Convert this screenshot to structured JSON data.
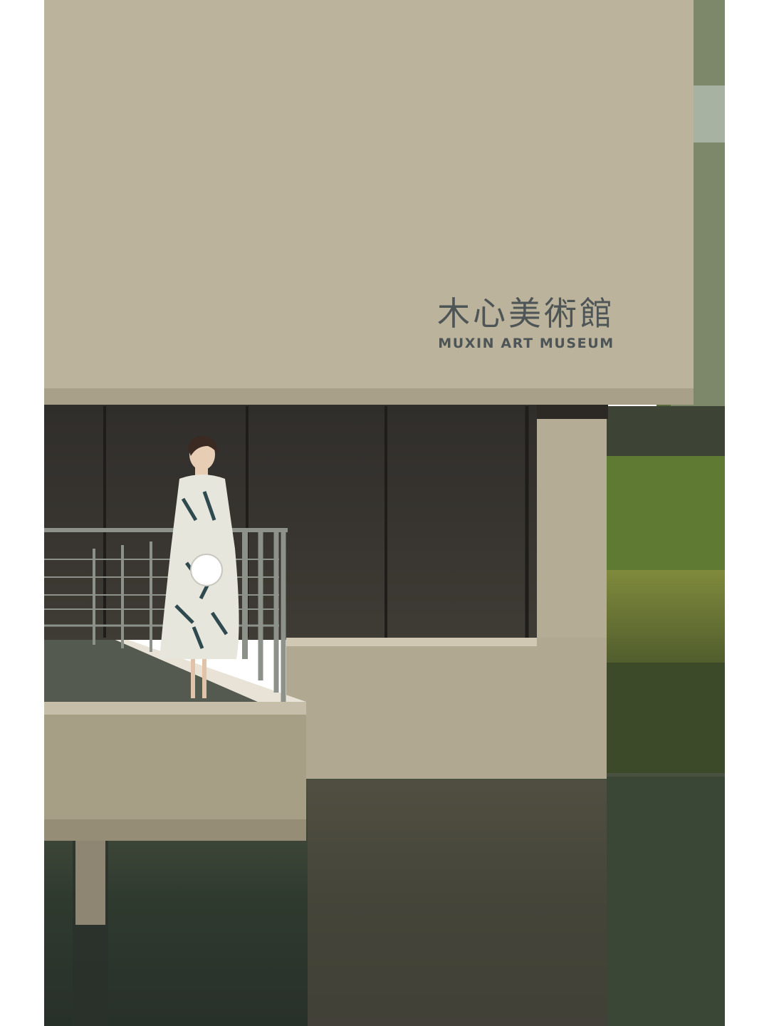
{
  "photo": {
    "subject": "museum-facade-with-person-on-balcony",
    "sign": {
      "chinese": "木心美術館",
      "english": "MUXIN ART MUSEUM"
    }
  },
  "colors": {
    "concrete": "#bcb39c",
    "concrete_shadow": "#a39a83",
    "glass": "#3a3733",
    "water": "#2f3a2f",
    "foliage": "#6f7f3c",
    "sign_text": "#4d5556",
    "page_border": "#ffffff"
  }
}
